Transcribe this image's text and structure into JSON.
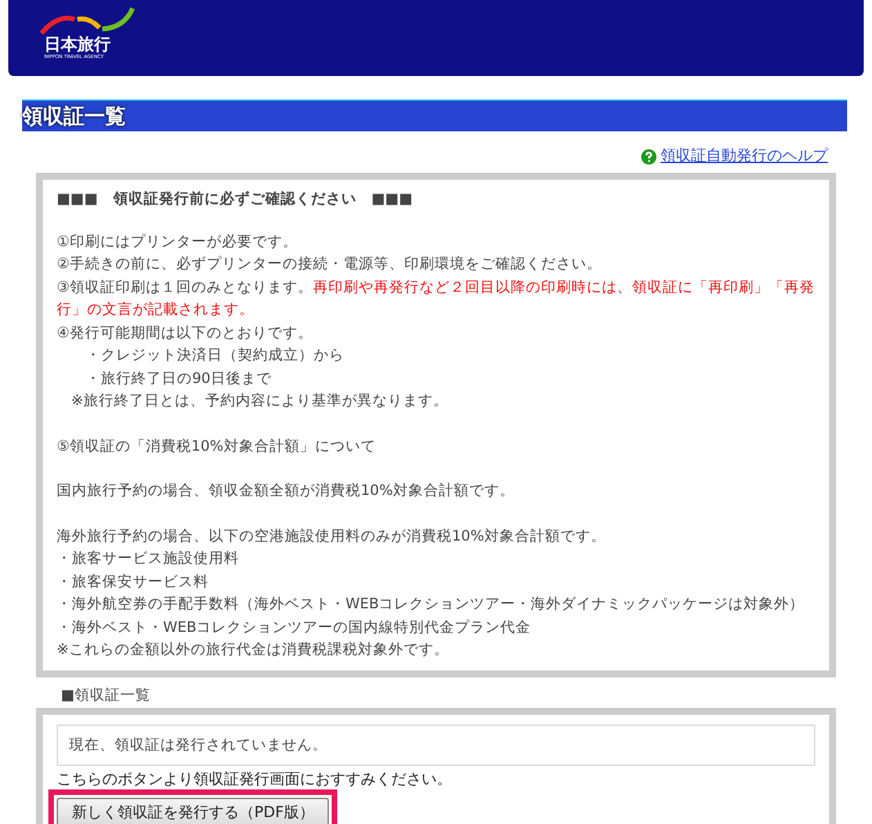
{
  "header": {
    "logo_text": "日本旅行",
    "logo_subtext": "NIPPON TRAVEL AGENCY"
  },
  "page_title": "領収証一覧",
  "help_link": "領収証自動発行のヘルプ",
  "notice": {
    "heading": "■■■　領収証発行前に必ずご確認ください　■■■",
    "paragraphs": [
      [
        {
          "kind": "plain",
          "text": "①印刷にはプリンターが必要です。"
        },
        {
          "kind": "plain",
          "text": "②手続きの前に、必ずプリンターの接続・電源等、印刷環境をご確認ください。"
        },
        {
          "kind": "plain",
          "text": "③領収証印刷は１回のみとなります。",
          "alert": "再印刷や再発行など２回目以降の印刷時には、領収証に「再印刷」「再発行」の文言が記載されます。"
        },
        {
          "kind": "plain",
          "text": "④発行可能期間は以下のとおりです。"
        },
        {
          "kind": "indented",
          "text": "・クレジット決済日（契約成立）から"
        },
        {
          "kind": "indented",
          "text": "・旅行終了日の90日後まで"
        },
        {
          "kind": "note",
          "text": "※旅行終了日とは、予約内容により基準が異なります。"
        }
      ],
      [
        {
          "kind": "plain",
          "text": "⑤領収証の「消費税10%対象合計額」について"
        }
      ],
      [
        {
          "kind": "plain",
          "text": "国内旅行予約の場合、領収金額全額が消費税10%対象合計額です。"
        }
      ],
      [
        {
          "kind": "plain",
          "text": "海外旅行予約の場合、以下の空港施設使用料のみが消費税10%対象合計額です。"
        },
        {
          "kind": "plain",
          "text": "・旅客サービス施設使用料"
        },
        {
          "kind": "plain",
          "text": "・旅客保安サービス料"
        },
        {
          "kind": "plain",
          "text": "・海外航空券の手配手数料（海外ベスト・WEBコレクションツアー・海外ダイナミックパッケージは対象外）"
        },
        {
          "kind": "plain",
          "text": "・海外ベスト・WEBコレクションツアーの国内線特別代金プラン代金"
        },
        {
          "kind": "plain",
          "text": "※これらの金額以外の旅行代金は消費税課税対象外です。"
        }
      ]
    ]
  },
  "receipts": {
    "label": "■領収証一覧",
    "status": "現在、領収証は発行されていません。",
    "instruction": "こちらのボタンより領収証発行画面におすすみください。",
    "button": "新しく領収証を発行する（PDF版）",
    "button_highlighted": true
  }
}
